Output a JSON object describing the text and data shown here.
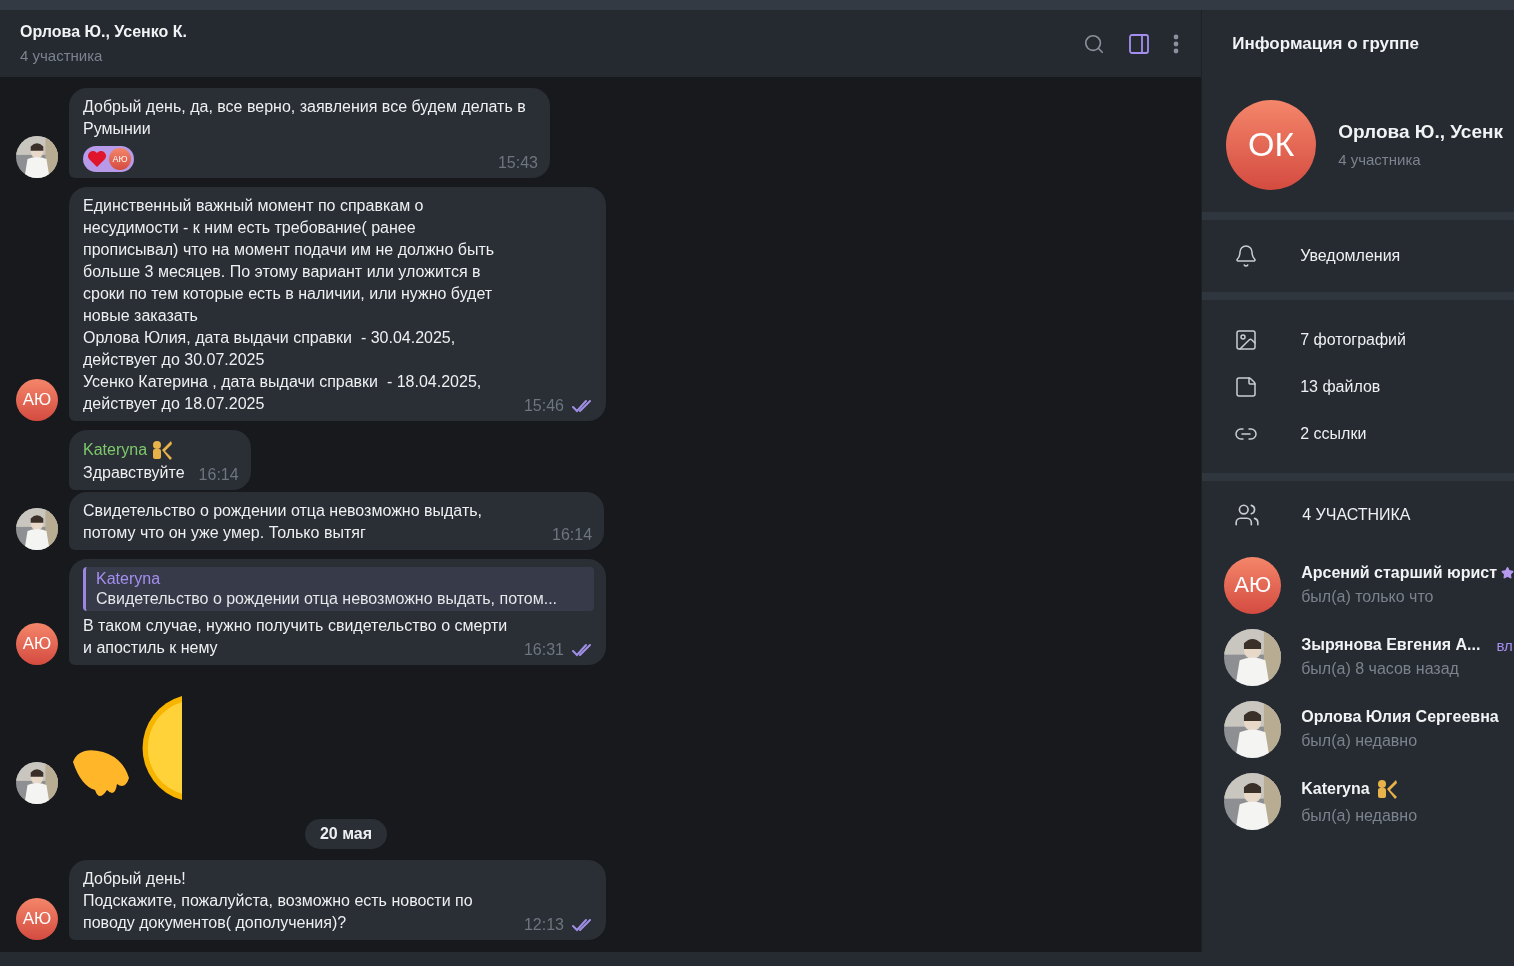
{
  "chat_header": {
    "title": "Орлова Ю., Усенко К.",
    "subtitle": "4 участника",
    "panel_toggle_on": true
  },
  "messages": [
    {
      "kind": "text",
      "text": "Добрый день, да, все верно, заявления все будем делать в Румынии",
      "reactions": [
        {
          "initials": "АЮ"
        }
      ],
      "time": "15:43"
    },
    {
      "kind": "text",
      "avatar": {
        "kind": "initials",
        "initials": "АЮ"
      },
      "text": "Единственный важный момент по справкам о несудимости - к ним есть требование( ранее прописывал) что на момент подачи им не должно быть больше 3 месяцев. По этому вариант или уложится в сроки по тем которые есть в наличии, или нужно будет новые заказать\nОрлова Юлия, дата выдачи справки  - 30.04.2025, действует до 30.07.2025\nУсенко Катерина , дата выдачи справки  - 18.04.2025, действует до 18.07.2025",
      "time": "15:46",
      "read": true
    },
    {
      "kind": "text",
      "sender": "Kateryna",
      "text": "Здравствуйте",
      "time": "16:14"
    },
    {
      "kind": "text",
      "text": "Свидетельство о рождении отца невозможно выдать, потому что он уже умер. Только вытяг",
      "time": "16:14"
    },
    {
      "kind": "text",
      "avatar": {
        "kind": "initials",
        "initials": "АЮ"
      },
      "reply": {
        "name": "Kateryna",
        "text": "Свидетельство о рождении отца невозможно выдать, потом..."
      },
      "text": "В таком случае, нужно получить свидетельство о смерти и апостиль к нему",
      "time": "16:31",
      "read": true
    },
    {
      "kind": "sticker"
    },
    {
      "kind": "date",
      "text": "20 мая"
    },
    {
      "kind": "text",
      "avatar": {
        "kind": "initials",
        "initials": "АЮ"
      },
      "text": "Добрый день!\nПодскажите, пожалуйста, возможно есть новости по поводу документов( дополучения)?",
      "time": "12:13",
      "read": true
    }
  ],
  "info_panel": {
    "title": "Информация о группе",
    "group": {
      "initials": "ОК",
      "name": "Орлова Ю., Усенк",
      "subtitle": "4 участника"
    },
    "notifications": {
      "label": "Уведомления"
    },
    "media": [
      {
        "kind": "photos",
        "label": "7 фотографий"
      },
      {
        "kind": "files",
        "label": "13 файлов"
      },
      {
        "kind": "links",
        "label": "2 ссылки"
      }
    ],
    "members_header": "4 УЧАСТНИКА",
    "members": [
      {
        "name": "Арсений старший юрист",
        "status": "был(а) только что",
        "avatar": {
          "kind": "initials",
          "initials": "АЮ"
        }
      },
      {
        "name": "Зырянова Евгения А...",
        "status": "был(а) 8 часов назад",
        "badge": "вл"
      },
      {
        "name": "Орлова Юлия Сергеевна",
        "status": "был(а) недавно"
      },
      {
        "name": "Kateryna",
        "status": "был(а) недавно"
      }
    ]
  }
}
